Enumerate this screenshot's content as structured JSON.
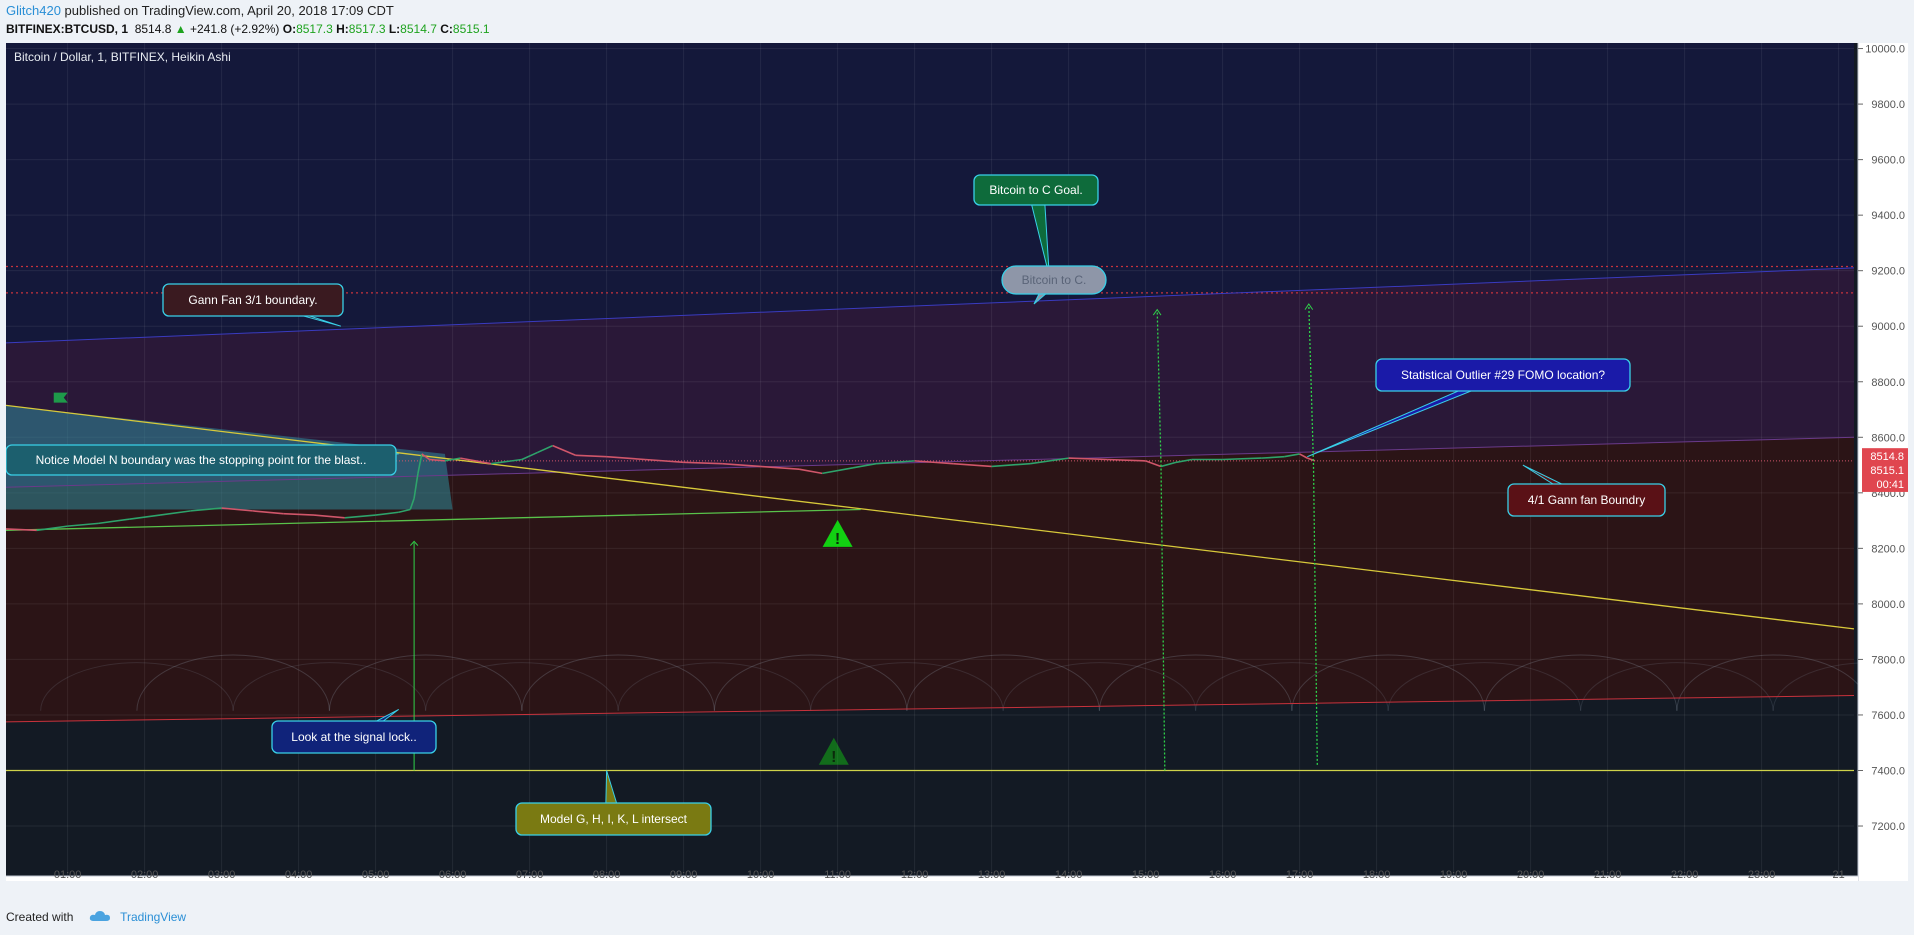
{
  "header": {
    "author": "Glitch420",
    "published_text": " published on TradingView.com, April 20, 2018 17:09 CDT",
    "symbol": "BITFINEX:BTCUSD",
    "interval": "1",
    "last": "8514.8",
    "change": "+241.8 (+2.92%)",
    "open_label": "O:",
    "open": "8517.3",
    "high_label": "H:",
    "high": "8517.3",
    "low_label": "L:",
    "low": "8514.7",
    "close_label": "C:",
    "close": "8515.1"
  },
  "footer": {
    "created_with": "Created with",
    "brand": "TradingView"
  },
  "colors": {
    "background": "#131a24",
    "upper_zone": "#14183a",
    "fan_zone": "#2a1838",
    "lower_zone": "#2b1416",
    "price_up": "#2ea36b",
    "price_down": "#d0566a",
    "trend_line": "#d8c93a",
    "support_line": "#59c24a",
    "dotted_level": "#c8323c",
    "signal_arrow": "#2fd24a",
    "callout_border": "#39d0e8",
    "teal_triangle": "#2f8a9a",
    "warning_green": "#12d012"
  },
  "chart_data": {
    "type": "line",
    "title": "Bitcoin / Dollar, 1, BITFINEX, Heikin Ashi",
    "xlabel": "",
    "ylabel": "",
    "x_ticks": [
      "01:00",
      "02:00",
      "03:00",
      "04:00",
      "05:00",
      "06:00",
      "07:00",
      "08:00",
      "09:00",
      "10:00",
      "11:00",
      "12:00",
      "13:00",
      "14:00",
      "15:00",
      "16:00",
      "17:00",
      "18:00",
      "19:00",
      "20:00",
      "21:00",
      "22:00",
      "23:00",
      "21"
    ],
    "xlim": [
      0.2,
      24.2
    ],
    "y_ticks": [
      7200,
      7400,
      7600,
      7800,
      8000,
      8200,
      8400,
      8600,
      8800,
      9000,
      9200,
      9400,
      9600,
      9800,
      10000
    ],
    "y_tick_labels": [
      "7200.0",
      "7400.0",
      "7600.0",
      "7800.0",
      "8000.0",
      "8200.0",
      "8400.0",
      "8600.0",
      "8800.0",
      "9000.0",
      "9200.0",
      "9400.0",
      "9600.0",
      "9800.0",
      "10000.0"
    ],
    "ylim": [
      7020,
      10020
    ],
    "grid": true,
    "legend": "none",
    "series": [
      {
        "values_x": [
          0.2,
          0.6,
          1.0,
          1.4,
          1.8,
          2.2,
          2.6,
          3.0,
          3.4,
          3.8,
          4.2,
          4.6,
          5.0,
          5.3,
          5.45,
          5.5,
          5.55,
          5.6,
          5.7,
          5.9,
          6.1,
          6.5,
          6.9,
          7.1,
          7.3,
          7.6,
          8.0,
          8.5,
          9.0,
          9.5,
          10.0,
          10.5,
          10.8,
          11.2,
          11.5,
          12.0,
          12.5,
          13.0,
          13.5,
          14.0,
          14.5,
          15.0,
          15.2,
          15.4,
          15.6,
          16.0,
          16.5,
          16.8,
          17.0,
          17.1,
          17.2
        ],
        "values_y": [
          8270,
          8265,
          8280,
          8290,
          8305,
          8320,
          8335,
          8345,
          8335,
          8325,
          8320,
          8310,
          8320,
          8330,
          8340,
          8380,
          8470,
          8540,
          8520,
          8515,
          8525,
          8505,
          8520,
          8545,
          8570,
          8535,
          8530,
          8520,
          8510,
          8505,
          8495,
          8485,
          8470,
          8490,
          8505,
          8515,
          8505,
          8495,
          8505,
          8525,
          8520,
          8515,
          8495,
          8510,
          8520,
          8520,
          8525,
          8530,
          8540,
          8525,
          8515
        ]
      }
    ],
    "levels": {
      "dotted_upper": 9215,
      "dotted_lower": 9120,
      "last_price_line": 8515,
      "horizontal_support": 7400
    },
    "price_labels": [
      "8514.8",
      "8515.1",
      "00:41"
    ],
    "annotations": [
      {
        "text": "Bitcoin to C Goal.",
        "fill": "#0e6b3b",
        "target_x": 13.75,
        "target_y": 9180
      },
      {
        "text": "Bitcoin to C.",
        "fill": "#8e96a8",
        "target_x": 13.55,
        "target_y": 9080
      },
      {
        "text": "Gann Fan 3/1 boundary.",
        "fill": "#3a1a20",
        "target_x": 4.55,
        "target_y": 9000
      },
      {
        "text": "Statistical Outlier #29 FOMO location?",
        "fill": "#1a1aa8",
        "target_x": 17.1,
        "target_y": 8530
      },
      {
        "text": "Notice Model N boundary was the stopping point for the blast..",
        "fill": "#1c5f6e",
        "target_x": 5.3,
        "target_y": 8540
      },
      {
        "text": "4/1 Gann fan Boundry",
        "fill": "#5a1116",
        "target_x": 19.9,
        "target_y": 8500
      },
      {
        "text": "Look at the signal lock..",
        "fill": "#10237a",
        "target_x": 5.3,
        "target_y": 7620
      },
      {
        "text": "Model G, H, I, K, L intersect",
        "fill": "#7a7a12",
        "target_x": 8.0,
        "target_y": 7400
      }
    ]
  }
}
